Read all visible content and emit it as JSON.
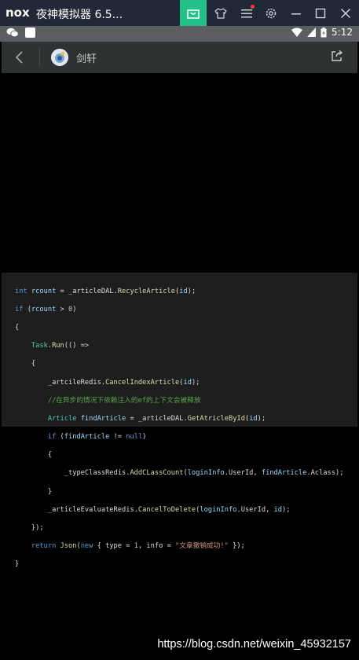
{
  "window": {
    "title": "夜神模拟器 6.5...",
    "logo_text": "nox",
    "buttons": [
      "store-icon",
      "shirt-icon",
      "menu-icon",
      "settings-icon",
      "minimize-icon",
      "maximize-icon",
      "close-icon"
    ],
    "accent": "#23c08a"
  },
  "status_bar": {
    "time": "5:12",
    "icons": [
      "wechat-icon",
      "app-square-icon",
      "wifi-icon",
      "signal-icon",
      "battery-icon"
    ]
  },
  "chat": {
    "name": "剑轩",
    "back_icon": "chevron-left-icon",
    "share_icon": "share-icon"
  },
  "code": {
    "lines": [
      "int rcount = _articleDAL.RecycleArticle(id);",
      "if (rcount > 0)",
      "{",
      "    Task.Run(() =>",
      "    {",
      "        _artcileRedis.CancelIndexArticle(id);",
      "        //在异步的情况下依赖注入的ef的上下文会被释放",
      "        Article findArticle = _articleDAL.GetAtricleById(id);",
      "        if (findArticle != null)",
      "        {",
      "            _typeClassRedis.AddCLassCount(loginInfo.UserId, findArticle.Aclass);",
      "        }",
      "        _articleEvaluateRedis.CancelToDelete(loginInfo.UserId, id);",
      "    });",
      "    return Json(new { type = 1, info = \"文章撤销成功!\" });",
      "}"
    ]
  },
  "watermark": "https://blog.csdn.net/weixin_45932157"
}
